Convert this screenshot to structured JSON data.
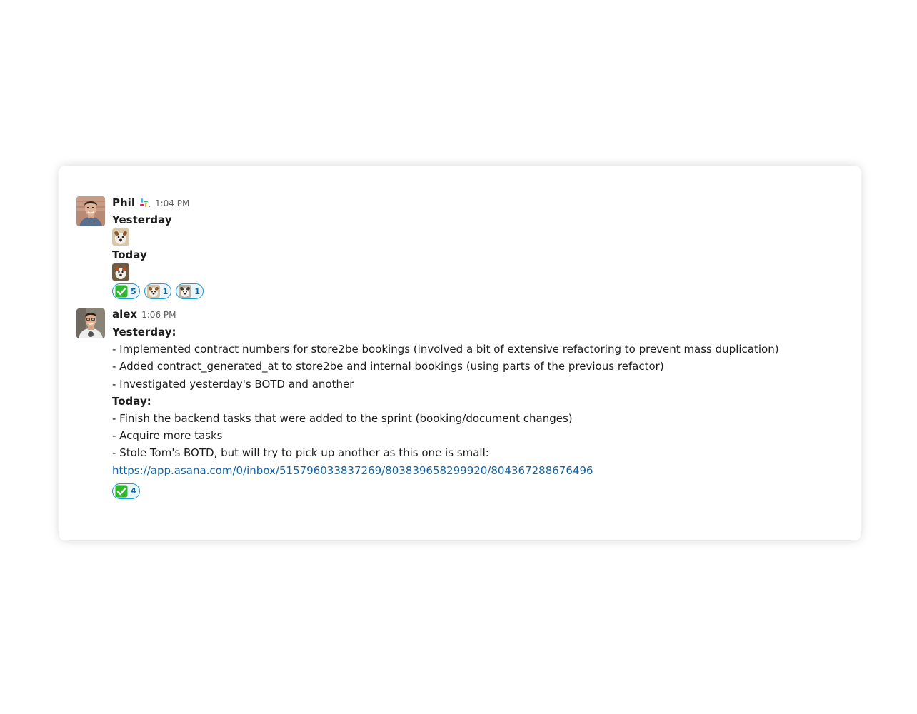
{
  "messages": [
    {
      "author": "Phil",
      "status_icon": "slack-logo-icon",
      "time": "1:04 PM",
      "blocks": {
        "yesterday_heading": "Yesterday",
        "yesterday_emoji": "dog-emoji-icon",
        "today_heading": "Today",
        "today_emoji": "dog-emoji-icon"
      },
      "reactions": [
        {
          "emoji": "white-check-mark-icon",
          "count": "5"
        },
        {
          "emoji": "dog-emoji-icon",
          "count": "1"
        },
        {
          "emoji": "dog-emoji-icon",
          "count": "1"
        }
      ]
    },
    {
      "author": "alex",
      "time": "1:06 PM",
      "yesterday_heading": "Yesterday:",
      "yesterday_items": [
        "- Implemented contract numbers for store2be bookings (involved a bit of extensive refactoring to prevent mass duplication)",
        "- Added contract_generated_at to store2be and internal bookings (using parts of the previous refactor)",
        "- Investigated yesterday's BOTD and another"
      ],
      "today_heading": "Today:",
      "today_items": [
        "- Finish the backend tasks that were added to the sprint (booking/document changes)",
        "- Acquire more tasks",
        "- Stole Tom's BOTD, but will try to pick up another as this one is small:"
      ],
      "link": "https://app.asana.com/0/inbox/515796033837269/803839658299920/804367288676496",
      "reactions": [
        {
          "emoji": "white-check-mark-icon",
          "count": "4"
        }
      ]
    }
  ],
  "colors": {
    "link": "#1264a3",
    "reaction_border": "#1d9bd1",
    "reaction_bg": "#e8f5fa",
    "check_green": "#2eb82e",
    "timestamp": "#616061"
  }
}
